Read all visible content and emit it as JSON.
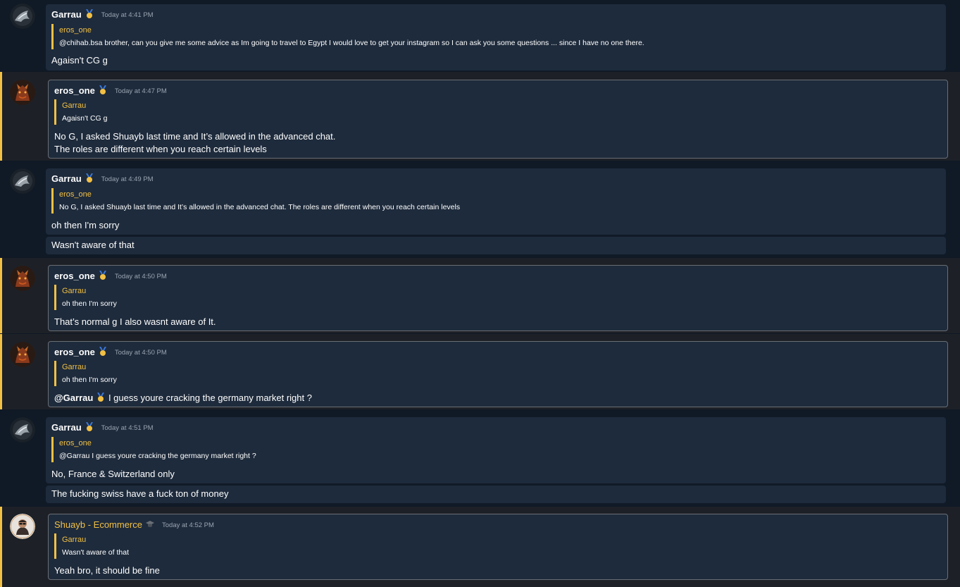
{
  "messages": [
    {
      "author": "Garrau",
      "time": "Today at 4:41 PM",
      "quote_author": "eros_one",
      "quote_text": "@chihab.bsa brother, can you give me some advice as Im going to travel to Egypt I would love to get your instagram so I can ask you some questions ... since I have no one there.",
      "text": "Agaisn't CG g"
    },
    {
      "author": "eros_one",
      "time": "Today at 4:47 PM",
      "quote_author": "Garrau",
      "quote_text": "Agaisn't CG g",
      "text_line1": "No G, I asked Shuayb last time and It’s allowed in the advanced chat.",
      "text_line2": "The roles are different when you reach certain levels"
    },
    {
      "author": "Garrau",
      "time": "Today at 4:49 PM",
      "quote_author": "eros_one",
      "quote_text": "No G, I asked Shuayb last time and It’s allowed in the advanced chat. The roles are different when you reach certain levels",
      "text": "oh then I'm sorry",
      "followup": "Wasn't aware of that"
    },
    {
      "author": "eros_one",
      "time": "Today at 4:50 PM",
      "quote_author": "Garrau",
      "quote_text": "oh then I'm sorry",
      "text": "That’s normal g I also wasnt aware of It."
    },
    {
      "author": "eros_one",
      "time": "Today at 4:50 PM",
      "quote_author": "Garrau",
      "quote_text": "oh then I'm sorry",
      "mention": "@Garrau",
      "text": "I guess youre cracking the germany market right ?"
    },
    {
      "author": "Garrau",
      "time": "Today at 4:51 PM",
      "quote_author": "eros_one",
      "quote_text": "@Garrau I guess youre cracking the germany market right ?",
      "text": "No, France & Switzerland only",
      "followup": "The fucking swiss have a fuck ton of money"
    },
    {
      "author": "Shuayb - Ecommerce",
      "time": "Today at 4:52 PM",
      "quote_author": "Garrau",
      "quote_text": "Wasn't aware of that",
      "text": "Yeah bro, it should be fine"
    }
  ],
  "colors": {
    "accent": "#f2c044",
    "background": "#0f1824",
    "bubble": "#1e2b3c",
    "own_row": "#1d2127"
  },
  "icons": {
    "medal": "medal-icon",
    "graduation": "graduation-cap-icon"
  }
}
